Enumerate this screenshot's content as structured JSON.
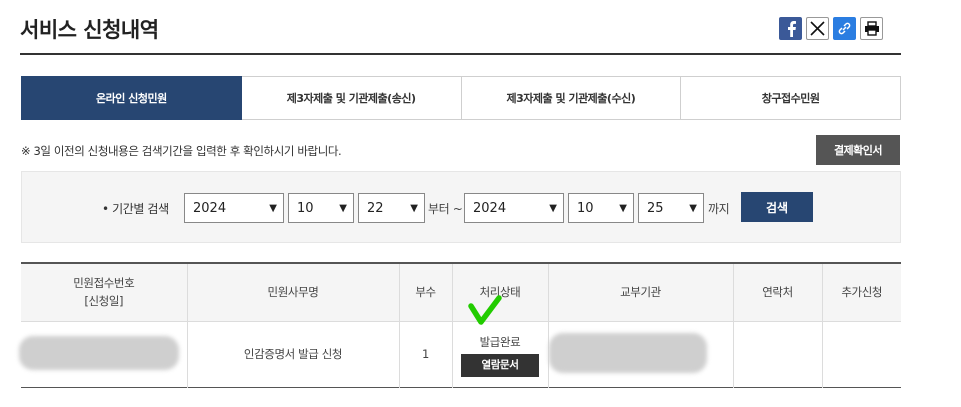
{
  "page": {
    "title": "서비스 신청내역"
  },
  "share": {
    "icons": [
      "facebook-icon",
      "x-icon",
      "link-icon",
      "print-icon"
    ]
  },
  "tabs": [
    {
      "label": "온라인 신청민원",
      "active": true
    },
    {
      "label": "제3자제출 및 기관제출(송신)",
      "active": false
    },
    {
      "label": "제3자제출 및 기관제출(수신)",
      "active": false
    },
    {
      "label": "창구접수민원",
      "active": false
    }
  ],
  "notice": "※ 3일 이전의 신청내용은 검색기간을 입력한 후 확인하시기 바랍니다.",
  "receipt_button": "결제확인서",
  "search": {
    "label": "• 기간별 검색",
    "from": {
      "year": "2024",
      "month": "10",
      "day": "22"
    },
    "from_suffix": "부터 ~",
    "to": {
      "year": "2024",
      "month": "10",
      "day": "25"
    },
    "to_suffix": "까지",
    "button": "검색"
  },
  "table": {
    "headers": [
      "민원접수번호",
      "[신청일]",
      "민원사무명",
      "부수",
      "처리상태",
      "교부기관",
      "연락처",
      "추가신청"
    ],
    "row": {
      "service": "인감증명서 발급 신청",
      "copies": "1",
      "status": "발급완료",
      "view_button": "열람문서"
    }
  },
  "colors": {
    "accent": "#274672",
    "check": "#22cc00"
  }
}
